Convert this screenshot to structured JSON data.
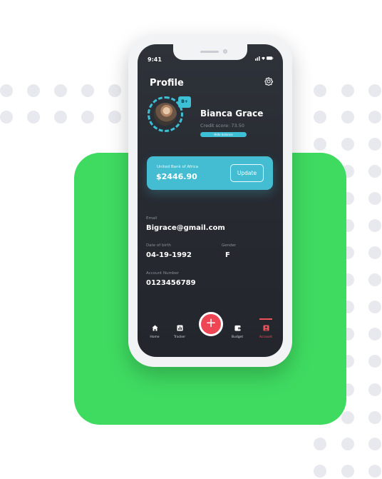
{
  "status": {
    "time": "9:41",
    "icons": "▐▐ ◔ ▬"
  },
  "header": {
    "title": "Profile",
    "settings_icon": "gear-icon"
  },
  "profile": {
    "grade": "B+",
    "name": "Bianca Grace",
    "credit_score": "Credit score: 73.50",
    "hide_balance": "Hide balance"
  },
  "bank": {
    "name": "United Bank of Africa",
    "balance": "$2446.90",
    "update_label": "Update"
  },
  "details": {
    "email_label": "Email",
    "email_value": "Bigrace@gmail.com",
    "dob_label": "Date of birth",
    "dob_value": "04-19-1992",
    "gender_label": "Gender",
    "gender_value": "F",
    "account_label": "Account Number",
    "account_value": "0123456789"
  },
  "tabbar": {
    "items": [
      {
        "label": "Home",
        "icon": "home-icon"
      },
      {
        "label": "Tracker",
        "icon": "chart-icon"
      },
      {
        "label": "Budget",
        "icon": "wallet-icon"
      },
      {
        "label": "Account",
        "icon": "user-icon"
      }
    ],
    "fab_label": "+"
  },
  "colors": {
    "accent": "#3dbfd6",
    "danger": "#ee4655",
    "green": "#3fdb61"
  }
}
